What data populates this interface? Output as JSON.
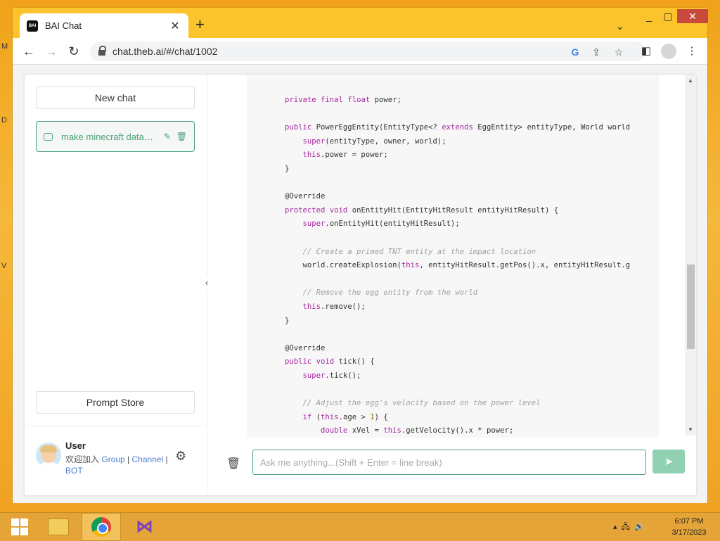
{
  "desktop": {
    "letters": [
      "M",
      "D",
      "V"
    ]
  },
  "browser": {
    "tab_title": "BAI Chat",
    "tab_favicon_text": "BAI",
    "url": "chat.theb.ai/#/chat/1002",
    "window_controls": {
      "minimize": "▁",
      "maximize": "▢",
      "close": "✕"
    }
  },
  "sidebar": {
    "new_chat_label": "New chat",
    "chats": [
      {
        "title": "make minecraft datapack"
      }
    ],
    "prompt_store_label": "Prompt Store",
    "user": {
      "name": "User",
      "welcome": "欢迎加入",
      "links": [
        "Group",
        "Channel",
        "BOT"
      ]
    }
  },
  "code": {
    "lines": [
      "private final float power;",
      "",
      "public PowerEggEntity(EntityType<? extends EggEntity> entityType, World world",
      "    super(entityType, owner, world);",
      "    this.power = power;",
      "}",
      "",
      "@Override",
      "protected void onEntityHit(EntityHitResult entityHitResult) {",
      "    super.onEntityHit(entityHitResult);",
      "",
      "    // Create a primed TNT entity at the impact location",
      "    world.createExplosion(this, entityHitResult.getPos().x, entityHitResult.g",
      "",
      "    // Remove the egg entity from the world",
      "    this.remove();",
      "}",
      "",
      "@Override",
      "public void tick() {",
      "    super.tick();",
      "",
      "    // Adjust the egg's velocity based on the power level",
      "    if (this.age > 1) {",
      "        double xVel = this.getVelocity().x * power;"
    ]
  },
  "input": {
    "placeholder": "Ask me anything...(Shift + Enter = line break)"
  },
  "taskbar": {
    "time": "6:07 PM",
    "date": "3/17/2023"
  }
}
